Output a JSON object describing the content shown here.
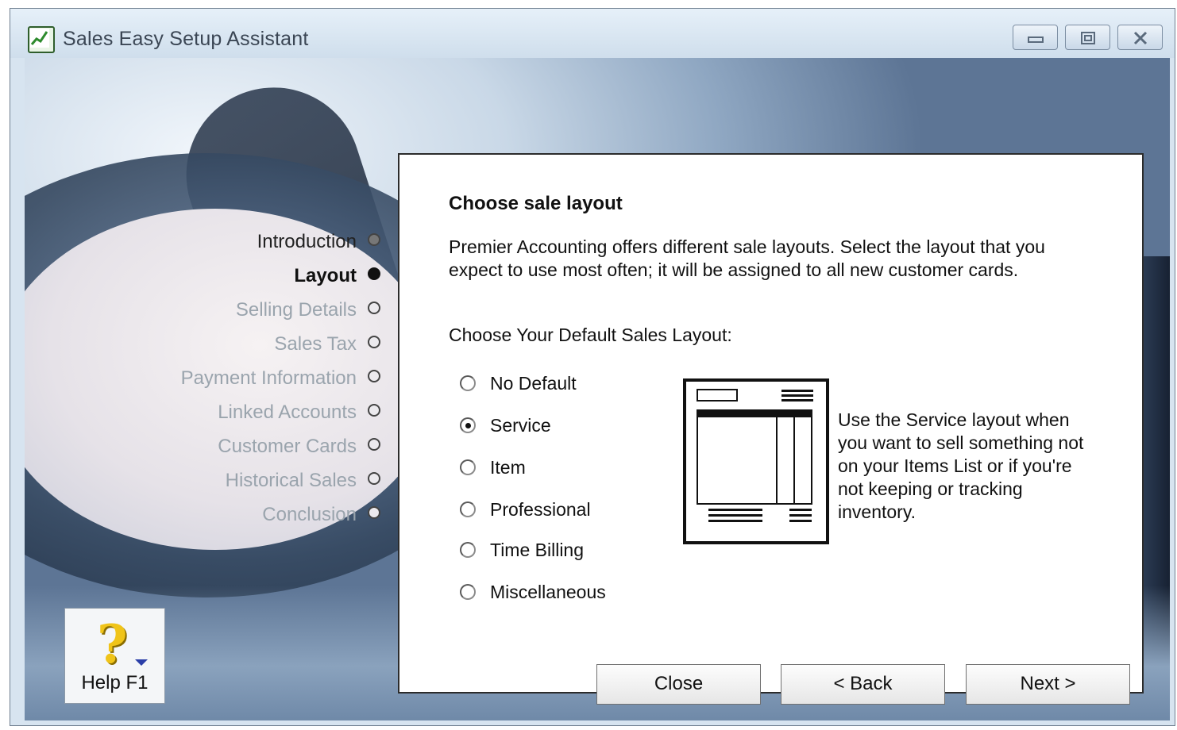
{
  "window": {
    "title": "Sales Easy Setup Assistant",
    "icon": "chart-icon"
  },
  "titlebar_buttons": [
    {
      "name": "minimize",
      "icon": "minimize-icon"
    },
    {
      "name": "maximize",
      "icon": "maximize-icon"
    },
    {
      "name": "close",
      "icon": "close-icon"
    }
  ],
  "steps": [
    {
      "label": "Introduction",
      "state": "done"
    },
    {
      "label": "Layout",
      "state": "current"
    },
    {
      "label": "Selling Details",
      "state": "pending"
    },
    {
      "label": "Sales Tax",
      "state": "pending"
    },
    {
      "label": "Payment Information",
      "state": "pending"
    },
    {
      "label": "Linked Accounts",
      "state": "pending"
    },
    {
      "label": "Customer Cards",
      "state": "pending"
    },
    {
      "label": "Historical Sales",
      "state": "pending"
    },
    {
      "label": "Conclusion",
      "state": "pending"
    }
  ],
  "panel": {
    "heading": "Choose sale layout",
    "intro": "Premier Accounting offers different sale layouts.  Select the layout that you expect to use most often; it will be assigned to all new customer cards.",
    "choose_label": "Choose Your Default Sales Layout:",
    "options": [
      {
        "label": "No Default",
        "selected": false
      },
      {
        "label": "Service",
        "selected": true
      },
      {
        "label": "Item",
        "selected": false
      },
      {
        "label": "Professional",
        "selected": false
      },
      {
        "label": "Time Billing",
        "selected": false
      },
      {
        "label": "Miscellaneous",
        "selected": false
      }
    ],
    "description": "Use the Service layout when you want to sell something not on your Items List or if you're not keeping or tracking inventory."
  },
  "help": {
    "label": "Help F1",
    "icon": "question-mark-icon"
  },
  "buttons": {
    "close": "Close",
    "back": "< Back",
    "next": "Next >"
  },
  "colors": {
    "step_pending": "#9aa4ad",
    "step_current": "#111111",
    "help_question": "#f0c419"
  }
}
